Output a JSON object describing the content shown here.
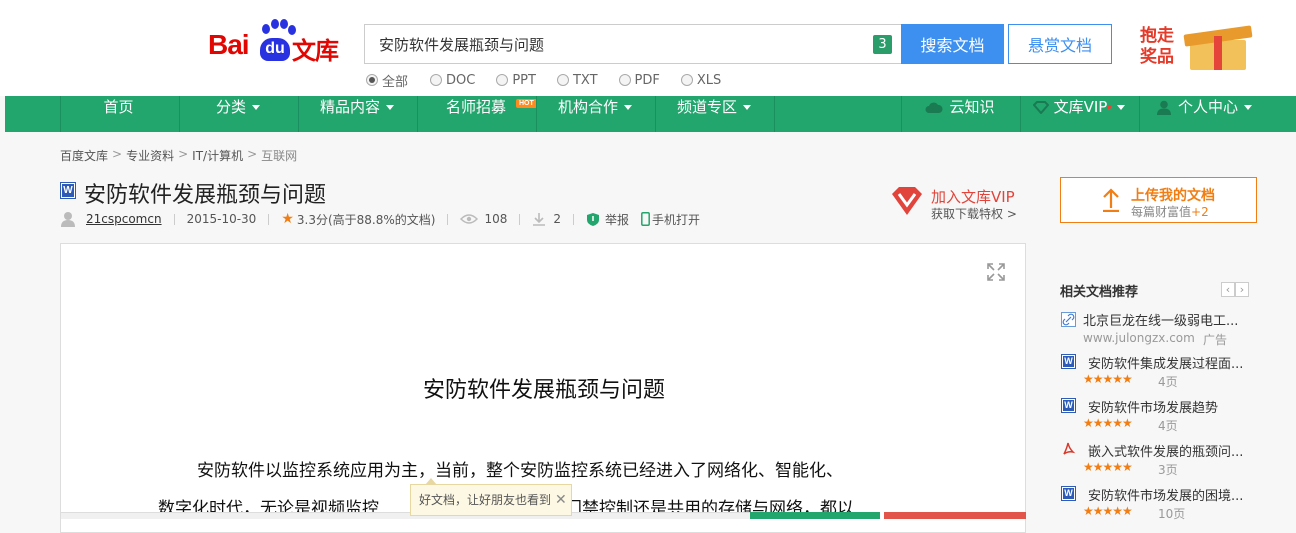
{
  "header": {
    "logo_text_bai": "Bai",
    "logo_text_du": "du",
    "logo_text_wenku": "文库",
    "search_value": "安防软件发展瓶颈与问题",
    "search_count": "3",
    "search_button": "搜索文档",
    "reward_button": "悬赏文档",
    "filters": [
      "全部",
      "DOC",
      "PPT",
      "TXT",
      "PDF",
      "XLS"
    ],
    "selected_filter": "全部",
    "promo_line1": "抱走",
    "promo_line2": "奖品"
  },
  "nav": {
    "items": [
      "首页",
      "分类",
      "精品内容",
      "名师招募",
      "机构合作",
      "频道专区"
    ],
    "hot_badge": "HOT",
    "right_items": [
      "云知识",
      "文库VIP",
      "个人中心"
    ]
  },
  "breadcrumb": [
    "百度文库",
    "专业资料",
    "IT/计算机",
    "互联网"
  ],
  "doc": {
    "title": "安防软件发展瓶颈与问题",
    "author": "21cspcomcn",
    "date": "2015-10-30",
    "rating": "3.3分(高于88.8%的文档)",
    "views": "108",
    "downloads": "2",
    "report": "举报",
    "mobile": "手机打开",
    "page_heading": "安防软件发展瓶颈与问题",
    "para1": "安防软件以监控系统应用为主，当前，整个安防监控系统已经进入了网络化、智能化、",
    "para2_head": "数字化时代，无论是视频监控",
    "para2_tail": "入、门禁控制还是共用的存储与网络，都以"
  },
  "vip": {
    "join": "加入文库VIP",
    "privilege": "获取下载特权 >"
  },
  "share_tip": {
    "text": "好文档，让好朋友也看到",
    "close": "✕"
  },
  "upload": {
    "title": "上传我的文档",
    "subtitle": "每篇财富值",
    "bonus": "+2"
  },
  "related": {
    "title": "相关文档推荐",
    "prev": "‹",
    "next": "›",
    "items": [
      {
        "type": "link",
        "title": "北京巨龙在线一级弱电工...",
        "sub": "www.julongzx.com",
        "ad": "广告"
      },
      {
        "type": "word",
        "title": "安防软件集成发展过程面...",
        "stars": "★★★★★",
        "pages": "4页"
      },
      {
        "type": "word",
        "title": "安防软件市场发展趋势",
        "stars": "★★★★★",
        "pages": "4页"
      },
      {
        "type": "pdf",
        "title": "嵌入式软件发展的瓶颈问...",
        "stars": "★★★★★",
        "pages": "3页"
      },
      {
        "type": "word",
        "title": "安防软件市场发展的困境...",
        "stars": "★★★★★",
        "pages": "10页"
      }
    ]
  },
  "colors": {
    "nav_green": "#23a56e",
    "search_blue": "#3d8ff0",
    "accent_orange": "#f07e14",
    "baidu_red": "#e10601"
  }
}
